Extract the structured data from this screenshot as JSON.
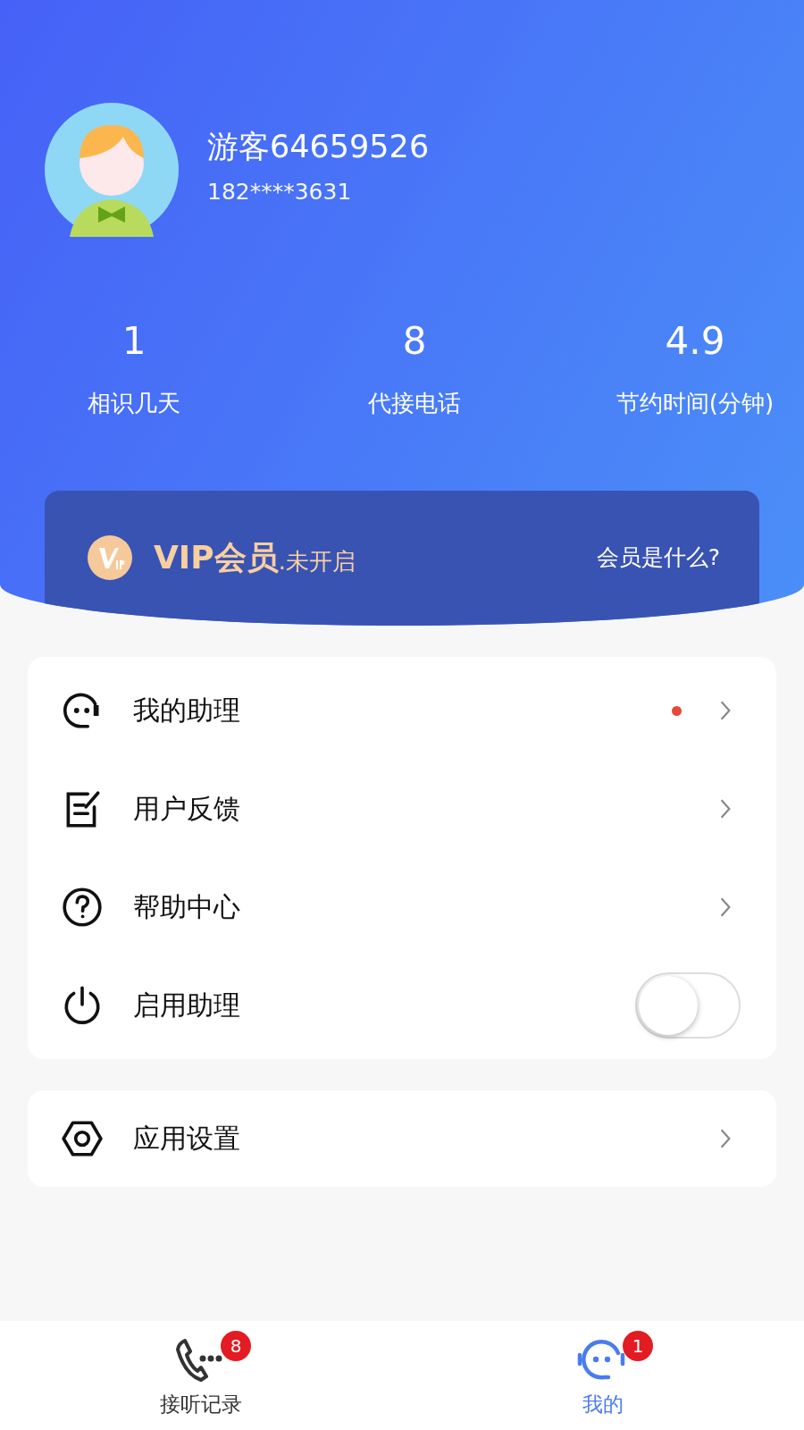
{
  "profile": {
    "name": "游客64659526",
    "phone": "182****3631"
  },
  "stats": [
    {
      "value": "1",
      "label": "相识几天"
    },
    {
      "value": "8",
      "label": "代接电话"
    },
    {
      "value": "4.9",
      "label": "节约时间(分钟)"
    }
  ],
  "vip": {
    "title": "VIP会员",
    "status": ".未开启",
    "link": "会员是什么?"
  },
  "menu": [
    {
      "label": "我的助理",
      "kind": "link",
      "dot": true
    },
    {
      "label": "用户反馈",
      "kind": "link",
      "dot": false
    },
    {
      "label": "帮助中心",
      "kind": "link",
      "dot": false
    },
    {
      "label": "启用助理",
      "kind": "toggle",
      "on": false
    }
  ],
  "settings": {
    "label": "应用设置"
  },
  "tabs": [
    {
      "label": "接听记录",
      "badge": "8",
      "selected": false
    },
    {
      "label": "我的",
      "badge": "1",
      "selected": true
    }
  ]
}
